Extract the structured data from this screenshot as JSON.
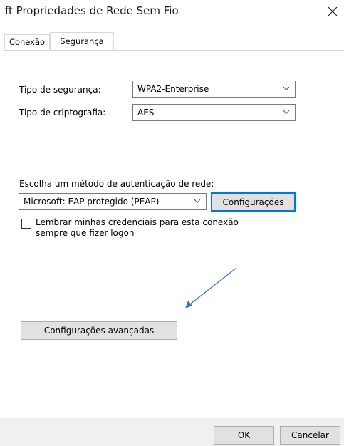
{
  "window": {
    "title": "ft Propriedades de Rede Sem Fio",
    "close_icon": "close-icon"
  },
  "tabs": [
    {
      "label": "Conexão",
      "active": false
    },
    {
      "label": "Segurança",
      "active": true
    }
  ],
  "security": {
    "type_label": "Tipo de segurança:",
    "type_value": "WPA2-Enterprise",
    "encryption_label": "Tipo de criptografia:",
    "encryption_value": "AES"
  },
  "auth": {
    "method_label": "Escolha um método de autenticação de rede:",
    "method_value": "Microsoft: EAP protegido (PEAP)",
    "settings_button": "Configurações",
    "remember_checked": false,
    "remember_label_line1": "Lembrar minhas credenciais para esta conexão",
    "remember_label_line2": "sempre que fizer logon"
  },
  "advanced": {
    "button_label": "Configurações avançadas"
  },
  "annotation": {
    "arrow_color": "#3a6fd8"
  },
  "footer": {
    "ok_label": "OK",
    "cancel_label": "Cancelar"
  },
  "colors": {
    "focus_border": "#0078d7",
    "button_bg": "#e1e1e1",
    "footer_bg": "#f0f0f0"
  }
}
